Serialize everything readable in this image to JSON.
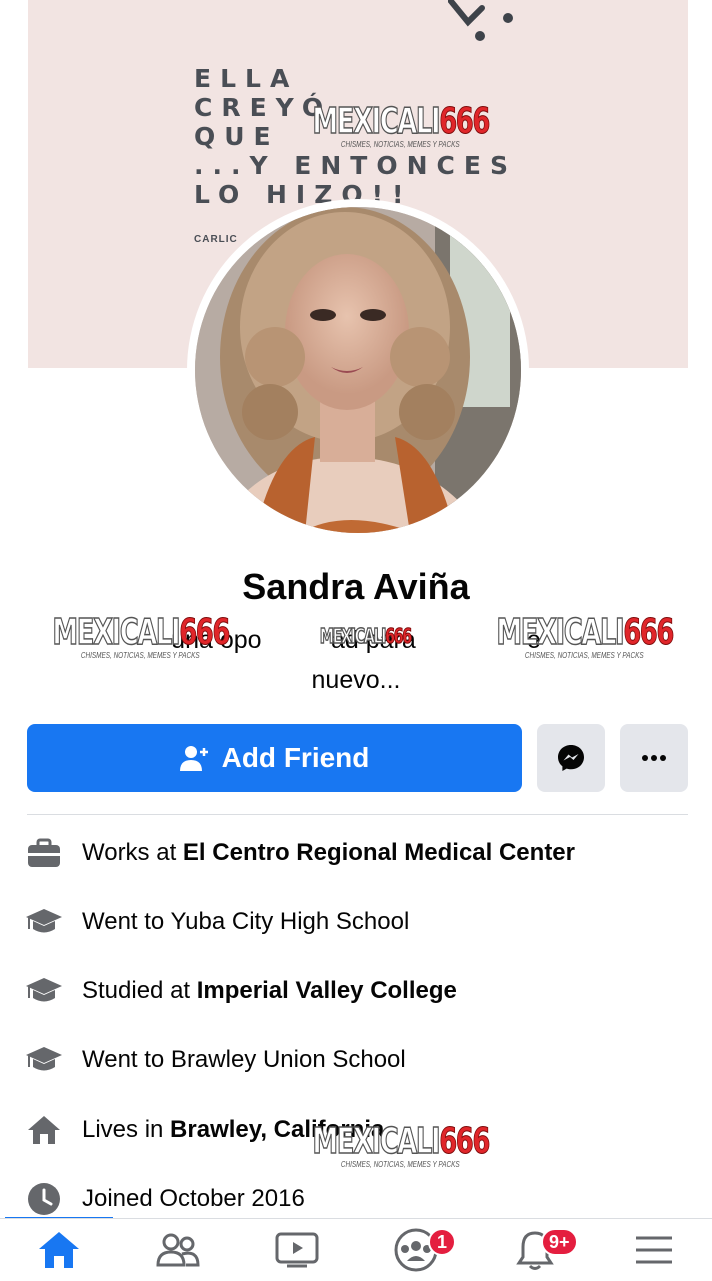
{
  "profile": {
    "cover": {
      "quote_lines": [
        "ELLA",
        "CREYÓ",
        "QUE",
        "...Y ENTONCES",
        "LO HIZO!!"
      ],
      "author": "CARLIC"
    },
    "name": "Sandra Aviña",
    "bio_visible": "una opo          ad para                e",
    "bio_line2": "nuevo..."
  },
  "actions": {
    "add_friend_label": "Add Friend",
    "messenger_icon": "messenger-icon",
    "more_icon": "more-icon"
  },
  "details": [
    {
      "icon": "briefcase-icon",
      "prefix": "Works at ",
      "bold": "El Centro Regional Medical Center",
      "suffix": ""
    },
    {
      "icon": "graduation-cap-icon",
      "prefix": "Went to Yuba City High School",
      "bold": "",
      "suffix": ""
    },
    {
      "icon": "graduation-cap-icon",
      "prefix": "Studied at ",
      "bold": "Imperial Valley College",
      "suffix": ""
    },
    {
      "icon": "graduation-cap-icon",
      "prefix": "Went to Brawley Union School",
      "bold": "",
      "suffix": ""
    },
    {
      "icon": "home-icon",
      "prefix": "Lives in ",
      "bold": "Brawley, California",
      "suffix": ""
    },
    {
      "icon": "clock-icon",
      "prefix": "Joined October 2016",
      "bold": "",
      "suffix": ""
    }
  ],
  "watermark": {
    "text_a": "MEXICALI",
    "text_b": "666",
    "subtitle": "CHISMES, NOTICIAS, MEMES Y PACKS"
  },
  "tabbar": {
    "items": [
      {
        "icon": "home-icon",
        "active": true
      },
      {
        "icon": "friends-icon"
      },
      {
        "icon": "video-icon"
      },
      {
        "icon": "groups-icon",
        "badge": "1"
      },
      {
        "icon": "bell-icon",
        "badge": "9+"
      },
      {
        "icon": "menu-icon"
      }
    ]
  },
  "colors": {
    "accent": "#1877f2",
    "badge": "#e41e3f",
    "cover_bg": "#f2e4e2"
  }
}
